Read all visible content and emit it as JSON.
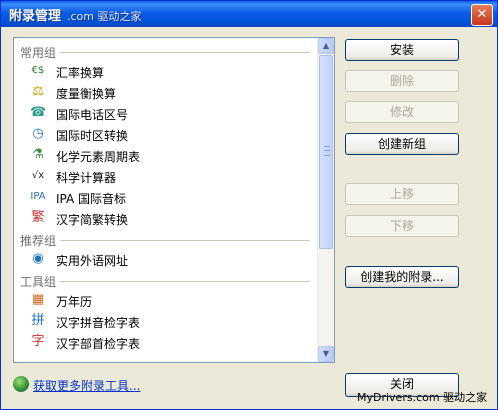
{
  "window": {
    "title": "附录管理",
    "title_extra": ".com 驱动之家"
  },
  "list": {
    "groups": [
      {
        "label": "常用组",
        "items": [
          {
            "label": "汇率换算",
            "icon": "currency-icon",
            "glyph": "€$",
            "color": "#2e7d32"
          },
          {
            "label": "度量衡换算",
            "icon": "scale-icon",
            "glyph": "⚖",
            "color": "#c8a000"
          },
          {
            "label": "国际电话区号",
            "icon": "phone-icon",
            "glyph": "☎",
            "color": "#2a9d8f"
          },
          {
            "label": "国际时区转换",
            "icon": "clock-icon",
            "glyph": "◷",
            "color": "#1e6fd9"
          },
          {
            "label": "化学元素周期表",
            "icon": "flask-icon",
            "glyph": "⚗",
            "color": "#3a8a3a"
          },
          {
            "label": "科学计算器",
            "icon": "sqrt-icon",
            "glyph": "√x",
            "color": "#222222"
          },
          {
            "label": "IPA 国际音标",
            "icon": "ipa-icon",
            "glyph": "IPA",
            "color": "#2b6cb0"
          },
          {
            "label": "汉字简繁转换",
            "icon": "hanzi-convert-icon",
            "glyph": "繁",
            "color": "#cc3333"
          }
        ]
      },
      {
        "label": "推荐组",
        "items": [
          {
            "label": "实用外语网址",
            "icon": "globe-icon",
            "glyph": "◉",
            "color": "#1a73c8"
          }
        ]
      },
      {
        "label": "工具组",
        "items": [
          {
            "label": "万年历",
            "icon": "calendar-icon",
            "glyph": "▦",
            "color": "#d2691e"
          },
          {
            "label": "汉字拼音检字表",
            "icon": "pinyin-icon",
            "glyph": "拼",
            "color": "#1a73c8"
          },
          {
            "label": "汉字部首检字表",
            "icon": "radical-icon",
            "glyph": "字",
            "color": "#cc3333"
          }
        ]
      }
    ]
  },
  "buttons": {
    "install": "安装",
    "delete": "删除",
    "modify": "修改",
    "new_group": "创建新组",
    "move_up": "上移",
    "move_down": "下移",
    "create_my": "创建我的附录...",
    "close": "关闭"
  },
  "footer": {
    "link": "获取更多附录工具...",
    "watermark": "MyDrivers.com 驱动之家"
  }
}
